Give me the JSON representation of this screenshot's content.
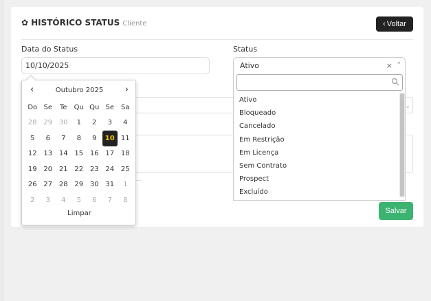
{
  "header": {
    "title": "HISTÓRICO STATUS",
    "subtitle": "Cliente",
    "back_label": "Voltar"
  },
  "form": {
    "date_label": "Data do Status",
    "date_value": "10/10/2025",
    "status_label": "Status",
    "status_value": "Ativo",
    "save_label": "Salvar"
  },
  "datepicker": {
    "month_label": "Outubro 2025",
    "weekdays": [
      "Do",
      "Se",
      "Te",
      "Qu",
      "Qu",
      "Se",
      "Sa"
    ],
    "days": [
      [
        "28",
        "29",
        "30",
        "1",
        "2",
        "3",
        "4"
      ],
      [
        "5",
        "6",
        "7",
        "8",
        "9",
        "10",
        "11"
      ],
      [
        "12",
        "13",
        "14",
        "15",
        "16",
        "17",
        "18"
      ],
      [
        "19",
        "20",
        "21",
        "22",
        "23",
        "24",
        "25"
      ],
      [
        "26",
        "27",
        "28",
        "29",
        "30",
        "31",
        "1"
      ],
      [
        "2",
        "3",
        "4",
        "5",
        "6",
        "7",
        "8"
      ]
    ],
    "selected_day": "10",
    "clear_label": "Limpar"
  },
  "status_options": [
    "Ativo",
    "Bloqueado",
    "Cancelado",
    "Em Restrição",
    "Em Licença",
    "Sem Contrato",
    "Prospect",
    "Excluído"
  ],
  "colors": {
    "save": "#3cb371",
    "dark": "#222222",
    "selected_text": "#f2c200"
  }
}
